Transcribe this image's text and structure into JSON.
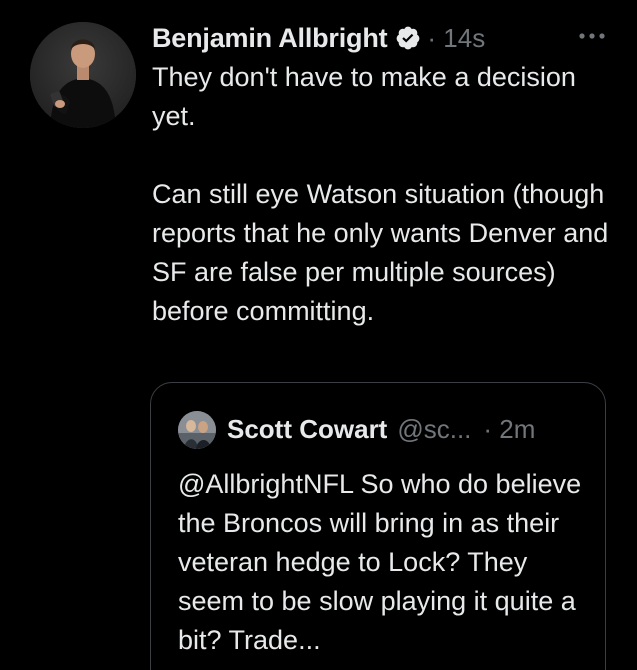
{
  "tweet": {
    "author_name": "Benjamin Allbright",
    "verified_icon": "verified-badge-icon",
    "timestamp": "· 14s",
    "more_icon": "more-horizontal-icon",
    "text": "They don't have to make a decision yet.\n\nCan still eye Watson situation (though reports that he only wants Denver and SF are false per multiple sources) before committing."
  },
  "quoted_tweet": {
    "author_name": "Scott Cowart",
    "handle": "@sc...",
    "timestamp": "· 2m",
    "text": "@AllbrightNFL So who do believe the Broncos will bring in as their veteran hedge to Lock? They seem to be slow playing it quite a bit? Trade..."
  },
  "colors": {
    "background": "#000000",
    "primary_text": "#e7e9ea",
    "secondary_text": "#71767b",
    "border": "#3b3f44"
  }
}
